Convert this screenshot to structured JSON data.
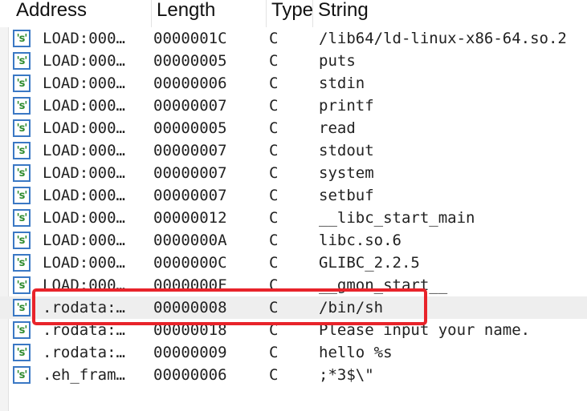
{
  "columns": {
    "address": "Address",
    "length": "Length",
    "type": "Type",
    "string": "String"
  },
  "icon_name": "string-literal-icon",
  "highlight_color": "#e8232a",
  "selected_row_index": 12,
  "rows": [
    {
      "address": "LOAD:000…",
      "length": "0000001C",
      "type": "C",
      "string": "/lib64/ld-linux-x86-64.so.2"
    },
    {
      "address": "LOAD:000…",
      "length": "00000005",
      "type": "C",
      "string": "puts"
    },
    {
      "address": "LOAD:000…",
      "length": "00000006",
      "type": "C",
      "string": "stdin"
    },
    {
      "address": "LOAD:000…",
      "length": "00000007",
      "type": "C",
      "string": "printf"
    },
    {
      "address": "LOAD:000…",
      "length": "00000005",
      "type": "C",
      "string": "read"
    },
    {
      "address": "LOAD:000…",
      "length": "00000007",
      "type": "C",
      "string": "stdout"
    },
    {
      "address": "LOAD:000…",
      "length": "00000007",
      "type": "C",
      "string": "system"
    },
    {
      "address": "LOAD:000…",
      "length": "00000007",
      "type": "C",
      "string": "setbuf"
    },
    {
      "address": "LOAD:000…",
      "length": "00000012",
      "type": "C",
      "string": "__libc_start_main"
    },
    {
      "address": "LOAD:000…",
      "length": "0000000A",
      "type": "C",
      "string": "libc.so.6"
    },
    {
      "address": "LOAD:000…",
      "length": "0000000C",
      "type": "C",
      "string": "GLIBC_2.2.5"
    },
    {
      "address": "LOAD:000…",
      "length": "0000000F",
      "type": "C",
      "string": "__gmon_start__"
    },
    {
      "address": ".rodata:…",
      "length": "00000008",
      "type": "C",
      "string": "/bin/sh"
    },
    {
      "address": ".rodata:…",
      "length": "00000018",
      "type": "C",
      "string": "Please input your name."
    },
    {
      "address": ".rodata:…",
      "length": "00000009",
      "type": "C",
      "string": "hello %s"
    },
    {
      "address": ".eh_fram…",
      "length": "00000006",
      "type": "C",
      "string": ";*3$\\\""
    }
  ]
}
